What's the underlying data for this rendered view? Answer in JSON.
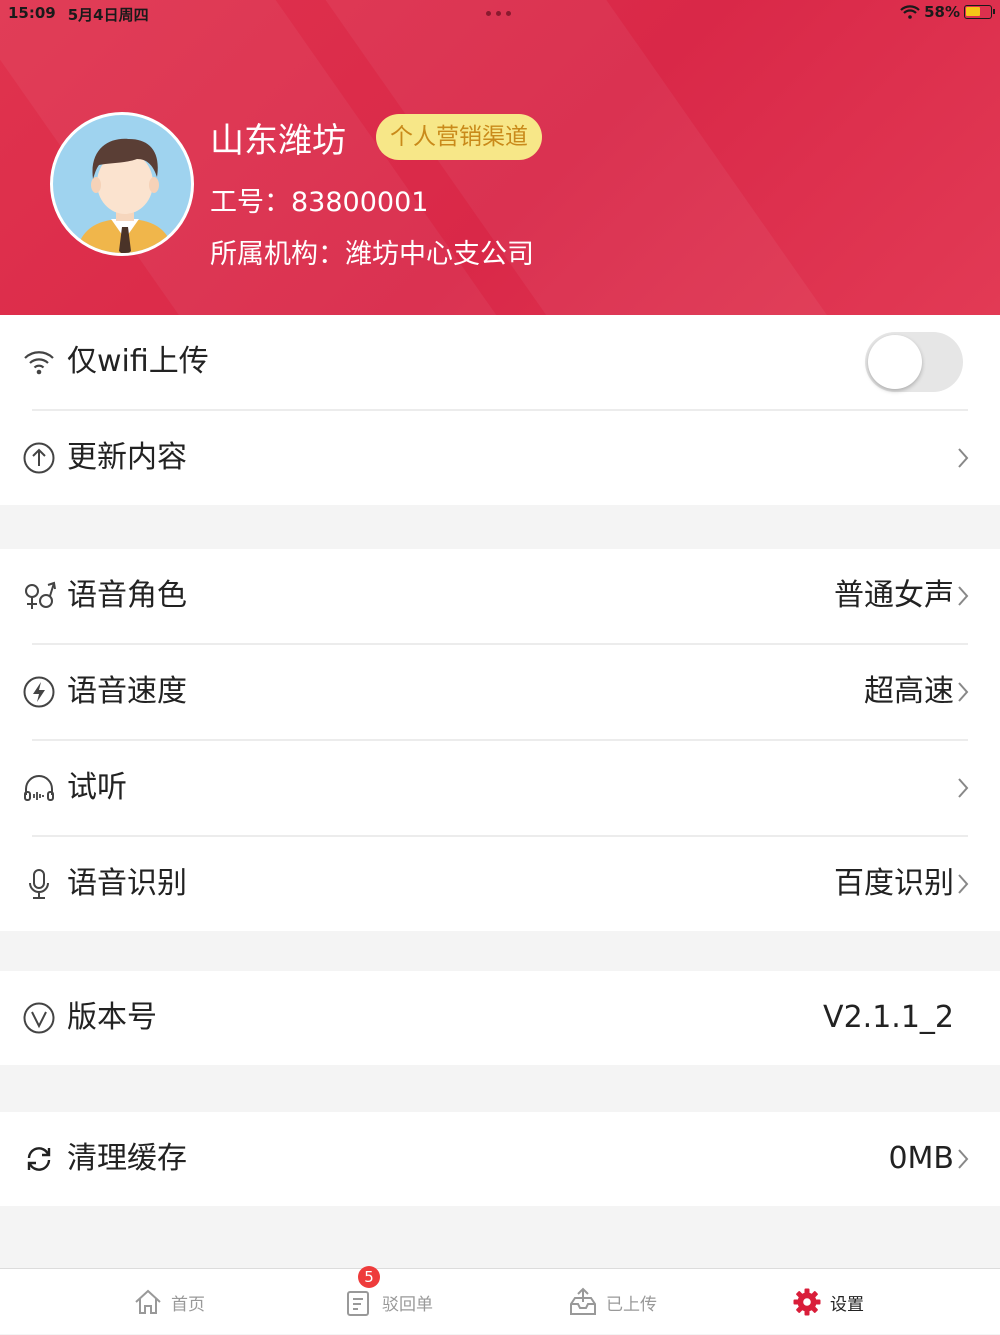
{
  "status_bar": {
    "time": "15:09",
    "date": "5月4日周四",
    "battery": "58%"
  },
  "profile": {
    "name": "山东潍坊",
    "badge": "个人营销渠道",
    "employee_no": "工号：83800001",
    "organization": "所属机构：潍坊中心支公司"
  },
  "settings": {
    "wifi_only": {
      "label": "仅wifi上传",
      "enabled": false,
      "icon": "wifi-icon"
    },
    "update": {
      "label": "更新内容",
      "icon": "upload-circle-icon"
    },
    "voice_role": {
      "label": "语音角色",
      "value": "普通女声",
      "icon": "gender-icon"
    },
    "voice_speed": {
      "label": "语音速度",
      "value": "超高速",
      "icon": "lightning-circle-icon"
    },
    "preview": {
      "label": "试听",
      "icon": "headphones-icon"
    },
    "recognition": {
      "label": "语音识别",
      "value": "百度识别",
      "icon": "microphone-icon"
    },
    "version": {
      "label": "版本号",
      "value": "V2.1.1_2",
      "icon": "version-icon"
    },
    "cache": {
      "label": "清理缓存",
      "value": "0MB",
      "icon": "refresh-icon"
    }
  },
  "tabs": [
    {
      "label": "首页",
      "icon": "home-icon",
      "active": false
    },
    {
      "label": "驳回单",
      "icon": "document-icon",
      "badge": "5",
      "active": false
    },
    {
      "label": "已上传",
      "icon": "inbox-upload-icon",
      "active": false
    },
    {
      "label": "设置",
      "icon": "gear-icon",
      "active": true
    }
  ],
  "colors": {
    "accent": "#d92848",
    "badge_bg": "#f7e788",
    "badge_text": "#c98a1a",
    "tab_active": "#d91e3a"
  }
}
